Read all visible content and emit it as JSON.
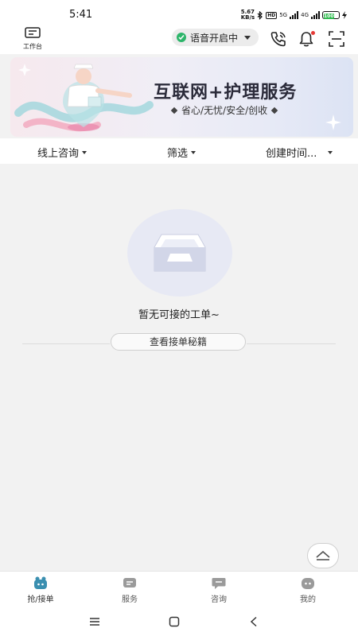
{
  "status_bar": {
    "time": "5:41",
    "speed_value": "5.67",
    "speed_unit": "KB/s",
    "hd_badge": "HD",
    "network_1": "5G",
    "network_2": "4G",
    "battery_level": "100"
  },
  "header": {
    "workbench_label": "工作台",
    "voice_status": "语音开启中"
  },
  "banner": {
    "title": "互联网+护理服务",
    "subtitle": "省心/无忧/安全/创收"
  },
  "filters": {
    "consult": "线上咨询",
    "filter": "筛选",
    "sort": "创建时间..."
  },
  "empty_state": {
    "message": "暂无可接的工单~",
    "tips_button": "查看接单秘籍"
  },
  "tabs": [
    {
      "label": "抢/接单",
      "icon": "grab-order-icon",
      "active": true
    },
    {
      "label": "服务",
      "icon": "service-icon",
      "active": false
    },
    {
      "label": "咨询",
      "icon": "consult-icon",
      "active": false
    },
    {
      "label": "我的",
      "icon": "profile-icon",
      "active": false
    }
  ],
  "colors": {
    "accent_green": "#2db56a",
    "active_tab": "#3a8fb0",
    "bell_dot": "#e53935"
  }
}
